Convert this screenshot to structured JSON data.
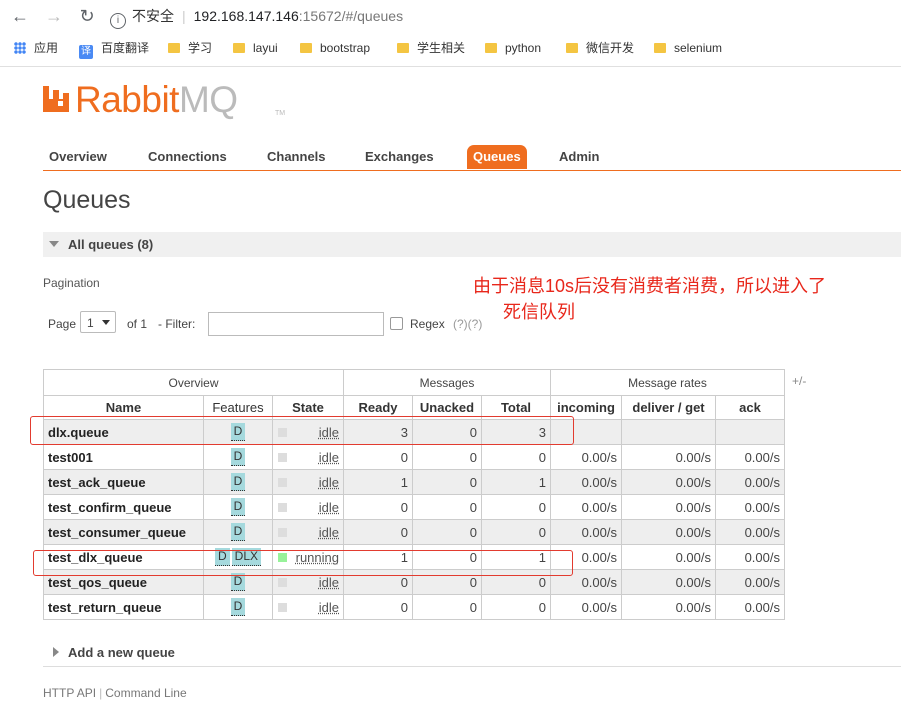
{
  "browser": {
    "security_label": "不安全",
    "url_host": "192.168.147.146",
    "url_path": ":15672/#/queues",
    "bookmarks": [
      "应用",
      "百度翻译",
      "学习",
      "layui",
      "bootstrap",
      "学生相关",
      "python",
      "微信开发",
      "selenium"
    ]
  },
  "logo": {
    "part1": "Rabbit",
    "part2": "MQ",
    "tm": "TM"
  },
  "tabs": [
    "Overview",
    "Connections",
    "Channels",
    "Exchanges",
    "Queues",
    "Admin"
  ],
  "active_tab": "Queues",
  "page_title": "Queues",
  "section_label": "All queues (8)",
  "pagination_label": "Pagination",
  "annotation": {
    "line1": "由于消息10s后没有消费者消费，所以进入了",
    "line2": "死信队列"
  },
  "pager": {
    "page_label": "Page",
    "page_value": "1",
    "of_label": "of 1",
    "filter_label": "- Filter:",
    "filter_value": "",
    "regex_label": "Regex",
    "regex_help": "(?)(?)"
  },
  "table": {
    "group_headers": [
      "Overview",
      "Messages",
      "Message rates"
    ],
    "plus_minus": "+/-",
    "columns": [
      "Name",
      "Features",
      "State",
      "Ready",
      "Unacked",
      "Total",
      "incoming",
      "deliver / get",
      "ack"
    ],
    "rows": [
      {
        "name": "dlx.queue",
        "features": [
          "D"
        ],
        "state": "idle",
        "ready": "3",
        "unacked": "0",
        "total": "3",
        "incoming": "",
        "deliver": "",
        "ack": ""
      },
      {
        "name": "test001",
        "features": [
          "D"
        ],
        "state": "idle",
        "ready": "0",
        "unacked": "0",
        "total": "0",
        "incoming": "0.00/s",
        "deliver": "0.00/s",
        "ack": "0.00/s"
      },
      {
        "name": "test_ack_queue",
        "features": [
          "D"
        ],
        "state": "idle",
        "ready": "1",
        "unacked": "0",
        "total": "1",
        "incoming": "0.00/s",
        "deliver": "0.00/s",
        "ack": "0.00/s"
      },
      {
        "name": "test_confirm_queue",
        "features": [
          "D"
        ],
        "state": "idle",
        "ready": "0",
        "unacked": "0",
        "total": "0",
        "incoming": "0.00/s",
        "deliver": "0.00/s",
        "ack": "0.00/s"
      },
      {
        "name": "test_consumer_queue",
        "features": [
          "D"
        ],
        "state": "idle",
        "ready": "0",
        "unacked": "0",
        "total": "0",
        "incoming": "0.00/s",
        "deliver": "0.00/s",
        "ack": "0.00/s"
      },
      {
        "name": "test_dlx_queue",
        "features": [
          "D",
          "DLX"
        ],
        "state": "running",
        "ready": "1",
        "unacked": "0",
        "total": "1",
        "incoming": "0.00/s",
        "deliver": "0.00/s",
        "ack": "0.00/s"
      },
      {
        "name": "test_qos_queue",
        "features": [
          "D"
        ],
        "state": "idle",
        "ready": "0",
        "unacked": "0",
        "total": "0",
        "incoming": "0.00/s",
        "deliver": "0.00/s",
        "ack": "0.00/s"
      },
      {
        "name": "test_return_queue",
        "features": [
          "D"
        ],
        "state": "idle",
        "ready": "0",
        "unacked": "0",
        "total": "0",
        "incoming": "0.00/s",
        "deliver": "0.00/s",
        "ack": "0.00/s"
      }
    ]
  },
  "add_queue_label": "Add a new queue",
  "footer": {
    "link1": "HTTP API",
    "link2": "Command Line"
  },
  "colors": {
    "brand_orange": "#ef6d1f",
    "annotation_red": "#e8271b",
    "feature_tag": "#a5d9dd",
    "running_green": "#98f29a"
  }
}
